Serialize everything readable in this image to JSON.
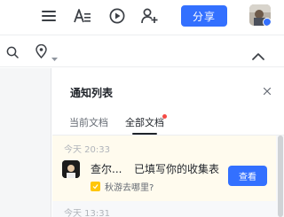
{
  "toolbar": {
    "share_label": "分享",
    "icons": [
      "menu-icon",
      "text-format-icon",
      "present-icon",
      "add-member-icon"
    ]
  },
  "secondbar": {
    "icons": [
      "search-icon",
      "location-pin-icon",
      "chevron-down-icon",
      "chevron-up-icon"
    ]
  },
  "notifications": {
    "title": "通知列表",
    "tabs": [
      {
        "label": "当前文档",
        "active": false
      },
      {
        "label": "全部文档",
        "active": true,
        "has_unread": true
      }
    ],
    "items": [
      {
        "time": "今天 20:33",
        "user": "查尔...",
        "action": "已填写你的收集表",
        "doc": "秋游去哪里?",
        "button": "查看"
      },
      {
        "time": "今天 13:31"
      }
    ]
  },
  "colors": {
    "accent": "#3370ff",
    "unread_dot": "#f54a45",
    "highlight_bg": "#fffbee",
    "doc_icon": "#ffc60a"
  }
}
